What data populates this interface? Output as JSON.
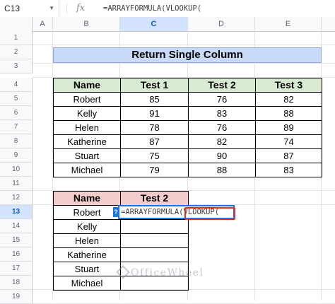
{
  "formula_bar": {
    "name_box": "C13",
    "fx_label": "fx",
    "formula": "=ARRAYFORMULA(VLOOKUP("
  },
  "columns": [
    "A",
    "B",
    "C",
    "D",
    "E"
  ],
  "rows": [
    "1",
    "2",
    "3",
    "4",
    "5",
    "6",
    "7",
    "8",
    "9",
    "10",
    "11",
    "12",
    "13",
    "14",
    "15",
    "16",
    "17",
    "18",
    "19"
  ],
  "selected_row": "13",
  "selected_column": "C",
  "title": "Return Single Column",
  "table1": {
    "headers": [
      "Name",
      "Test 1",
      "Test 2",
      "Test 3"
    ],
    "rows": [
      [
        "Robert",
        "85",
        "76",
        "82"
      ],
      [
        "Kelly",
        "91",
        "83",
        "88"
      ],
      [
        "Helen",
        "78",
        "76",
        "89"
      ],
      [
        "Katherine",
        "87",
        "82",
        "74"
      ],
      [
        "Stuart",
        "75",
        "90",
        "87"
      ],
      [
        "Michael",
        "79",
        "88",
        "83"
      ]
    ]
  },
  "table2": {
    "headers": [
      "Name",
      "Test 2"
    ],
    "rows": [
      [
        "Robert",
        ""
      ],
      [
        "Kelly",
        ""
      ],
      [
        "Helen",
        ""
      ],
      [
        "Katherine",
        ""
      ],
      [
        "Stuart",
        ""
      ],
      [
        "Michael",
        ""
      ]
    ]
  },
  "cell_edit": {
    "text": "=ARRAYFORMULA(VLOOKUP(",
    "help_icon": "?"
  },
  "watermark": "OfficeWheel",
  "colors": {
    "title_bg": "#c9daf8",
    "table1_header_bg": "#d9ead3",
    "table2_header_bg": "#f4cccc",
    "selection_blue": "#1a73e8",
    "highlight_red": "#e0302a"
  }
}
